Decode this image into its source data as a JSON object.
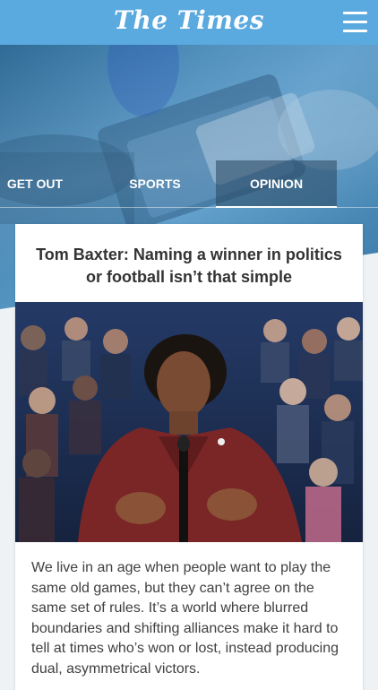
{
  "header": {
    "logo_text": "The Times",
    "menu_icon": "hamburger-menu-icon",
    "background_color": "#5aa9df"
  },
  "tabs": [
    {
      "label": "GET OUT",
      "active": false
    },
    {
      "label": "SPORTS",
      "active": false
    },
    {
      "label": "OPINION",
      "active": true
    }
  ],
  "article": {
    "title": "Tom Baxter: Naming a winner in politics or football isn’t that simple",
    "excerpt": "We live in an age when people want to play the same old games, but they can’t agree on the same set of rules. It’s a world where blurred boundaries and shifting alliances make it hard to tell at times who’s won or lost, instead producing dual, asymmetrical victors."
  },
  "colors": {
    "accent": "#5aa9df",
    "card_bg": "#ffffff",
    "page_bg": "#eef2f5",
    "title_text": "#333333"
  }
}
